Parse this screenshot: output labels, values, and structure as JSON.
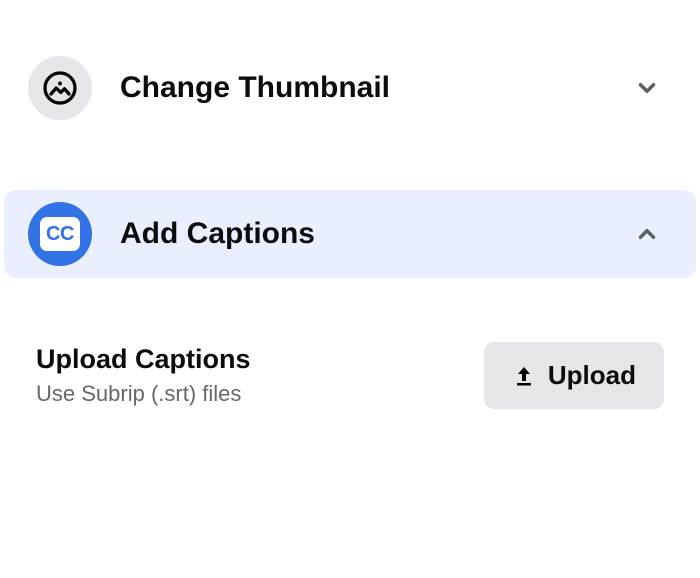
{
  "thumbnail": {
    "label": "Change Thumbnail",
    "expanded": false
  },
  "captions": {
    "label": "Add Captions",
    "expanded": true,
    "content": {
      "title": "Upload Captions",
      "subtitle": "Use Subrip (.srt) files",
      "button_label": "Upload"
    }
  }
}
